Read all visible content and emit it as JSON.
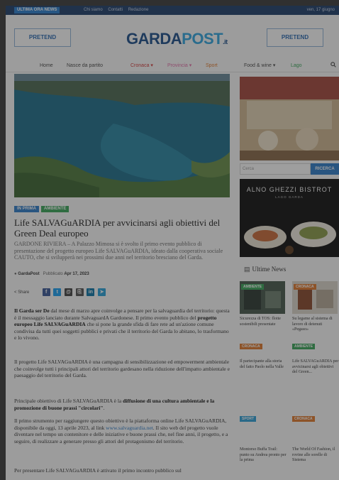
{
  "topbar": {
    "news_button": "ULTIMA ORA NEWS",
    "links": [
      "Chi siamo",
      "Contatti",
      "Redazione"
    ],
    "date": "ven, 17 giugno"
  },
  "header": {
    "promo_left": "PRETEND",
    "promo_right": "PRETEND",
    "logo_garda": "GARDA",
    "logo_post": "POST",
    "logo_tld": ".it"
  },
  "nav": {
    "items": [
      "Home",
      "Nasce da partito",
      "Cronaca ▾",
      "Provincia ▾",
      "Sport",
      "Food & wine ▾",
      "Lago"
    ],
    "search_icon": "search-icon"
  },
  "article": {
    "tag_primary": "IN PRIMA",
    "tag_secondary": "AMBIENTE",
    "title": "Life SALVAGuARDIA per avvicinarsi agli obiettivi del Green Deal europeo",
    "lead": "GARDONE RIVIERA – A Palazzo Mimosa si è svolto il primo evento pubblico di presentazione del progetto europeo Life SALVAGuARDIA, ideato dalla cooperativa sociale CAUTO, che si svilupperà nei prossimi due anni nel territorio bresciano del Garda.",
    "byline_author": "GardaPost",
    "byline_date_prefix": "Pubblicato",
    "byline_date": "Apr 17, 2023",
    "share_label": "Share",
    "paragraphs": {
      "p1_a": "Il Garda ser De",
      "p1_b": " dal mese di marzo apre coinvolge a pensare per la salvaguardia del territorio: questa è il messaggio lanciato durante SalvaguardA Gardonese. Il primo evento pubblico del ",
      "p1_c": "progetto europeo Life SALVAGuARDIA",
      "p1_d": " che si pone la grande sfida di fare rete ad un'azione comune condivisa da tutti quei soggetti pubblici e privati che il territorio del Garda lo abitano, lo trasformano e lo vivono.",
      "p2": "Il progetto Life SALVAGuARDIA è una campagna di sensibilizzazione ed empowerment ambientale che coinvolge tutti i principali attori del territorio gardesano nella riduzione dell'impatto ambientale e paesaggio del territorio del Garda.",
      "p3_a": "Principale obiettivo di Life SALVAGuARDIA è la ",
      "p3_b": "diffusione di una cultura ambientale e la promozione di buone prassi \"circolari\"",
      "p3_c": ".",
      "p4_a": "Il primo strumento per raggiungere questo obiettivo è la piattaforma online Life SALVAGuARDIA, disponibile da oggi, 13 aprile 2023, al link ",
      "p4_link": "www.salvaguardia.net",
      "p4_b": ". Il sito web del progetto vuole diventare nel tempo un contenitore e delle iniziative e buone prassi che, nel fine anni, il progetto, e a seguire, di realizzare a generare presso gli attori del protagonismo del territorio.",
      "p5": "Per presentare Life SALVAGuARDIA è attivato il primo incontro pubblico sul"
    }
  },
  "sidebar": {
    "search_placeholder": "Cerca",
    "search_button": "RICERCA",
    "ad2_brand": "ALNO GHEZZI BISTROT",
    "ad2_sub": "LAGO GARDA",
    "ultime_icon": "news-icon",
    "ultime_label": "Ultime News",
    "news": [
      {
        "badge": "AMBIENTE",
        "badge_color": "#3aa65a",
        "title": "Sicurezza di TOS: flotte sostenibili presentate"
      },
      {
        "badge": "CRONACA",
        "badge_color": "#e07a2e",
        "title": "Su legame al sistema di lavoro di detenuti «Pegaso»"
      },
      {
        "badge": "CRONACA",
        "badge_color": "#e07a2e",
        "title": "Il partecipante alla storia del fatto Paolo nella Valle"
      },
      {
        "badge": "AMBIENTE",
        "badge_color": "#3aa65a",
        "title": "Life SALVAGuARDIA per avvicinarsi agli obiettivi del Green..."
      },
      {
        "badge": "SPORT",
        "badge_color": "#2fa1d8",
        "title": "Montorso Buffa Trail: punto su Andrea pronto per la prima"
      },
      {
        "badge": "CRONACA",
        "badge_color": "#e07a2e",
        "title": "The World Of Fashion, il rovine alle sorelle di Sistema"
      }
    ]
  },
  "colors": {
    "topbar": "#1f3f6c",
    "accent_blue": "#2f7dc9",
    "accent_green": "#3aa65a",
    "logo_dark": "#1e4f8c",
    "logo_light": "#31a7e0"
  }
}
